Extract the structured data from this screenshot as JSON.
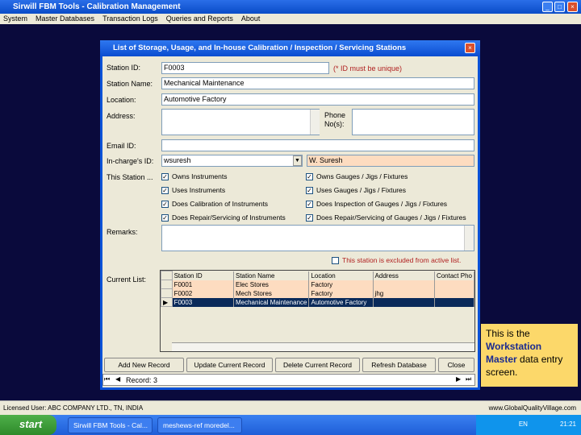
{
  "app": {
    "title": "Sirwill FBM Tools - Calibration Management"
  },
  "menu": [
    "System",
    "Master Databases",
    "Transaction Logs",
    "Queries and Reports",
    "About"
  ],
  "dialog": {
    "title": "List of Storage, Usage, and In-house Calibration / Inspection / Servicing Stations",
    "labels": {
      "station_id": "Station ID:",
      "station_name": "Station Name:",
      "location": "Location:",
      "address": "Address:",
      "phone": "Phone No(s):",
      "email": "Email ID:",
      "incharge": "In-charge's ID:",
      "this_station": "This Station ...",
      "remarks": "Remarks:",
      "current_list": "Current List:"
    },
    "station_id": "F0003",
    "unique_note": "(* ID must be unique)",
    "station_name": "Mechanical Maintenance",
    "location": "Automotive Factory",
    "address": "",
    "phone": "",
    "email": "",
    "incharge_id": "wsuresh",
    "incharge_name": "W. Suresh",
    "checks": [
      {
        "label": "Owns Instruments",
        "checked": true
      },
      {
        "label": "Owns Gauges / Jigs / Fixtures",
        "checked": true
      },
      {
        "label": "Uses Instruments",
        "checked": true
      },
      {
        "label": "Uses Gauges / Jigs / Fixtures",
        "checked": true
      },
      {
        "label": "Does Calibration of Instruments",
        "checked": true
      },
      {
        "label": "Does Inspection of Gauges / Jigs / Fixtures",
        "checked": true
      },
      {
        "label": "Does Repair/Servicing of Instruments",
        "checked": true
      },
      {
        "label": "Does Repair/Servicing of Gauges / Jigs / Fixtures",
        "checked": true
      }
    ],
    "remarks": "",
    "excluded_label": "This station is excluded from active list.",
    "grid": {
      "columns": [
        "Station ID",
        "Station Name",
        "Location",
        "Address",
        "Contact Pho"
      ],
      "rows": [
        [
          "F0001",
          "Elec Stores",
          "Factory",
          "",
          ""
        ],
        [
          "F0002",
          "Mech Stores",
          "Factory",
          "jhg",
          ""
        ],
        [
          "F0003",
          "Mechanical Maintenance",
          "Automotive Factory",
          "",
          ""
        ]
      ]
    },
    "buttons": {
      "add": "Add New Record",
      "update": "Update Current Record",
      "delete": "Delete Current Record",
      "refresh": "Refresh Database",
      "close": "Close"
    },
    "record": "Record: 3"
  },
  "callout": {
    "pre": "This is the ",
    "bold": "Workstation Master",
    "post": " data entry screen."
  },
  "status": {
    "left": "Licensed User: ABC COMPANY LTD., TN, INDIA",
    "right": "www.GlobalQualityVillage.com"
  },
  "taskbar": {
    "start": "start",
    "tasks": [
      "Sirwill FBM Tools - Cal...",
      "meshews-ref moredel..."
    ],
    "lang": "EN",
    "clock": "21:21"
  }
}
